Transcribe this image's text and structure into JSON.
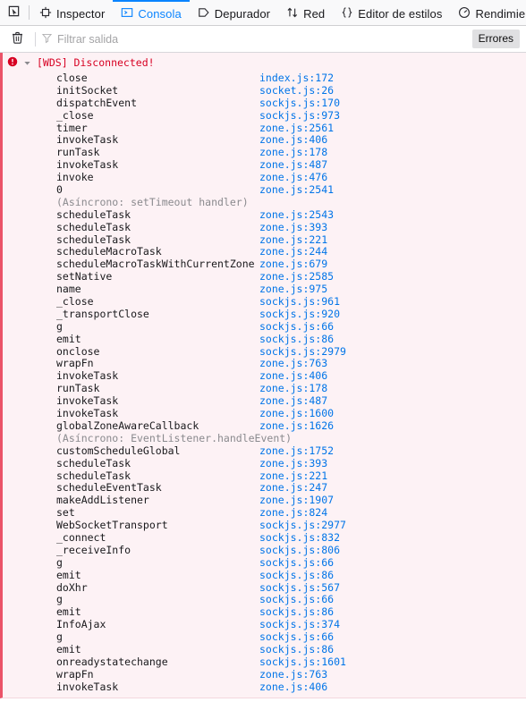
{
  "toolbox": {
    "picker_icon": "element-picker-icon",
    "tabs": [
      {
        "id": "inspector",
        "label": "Inspector",
        "icon": "inspector-target-icon",
        "selected": false
      },
      {
        "id": "console",
        "label": "Consola",
        "icon": "console-prompt-icon",
        "selected": true
      },
      {
        "id": "debugger",
        "label": "Depurador",
        "icon": "debugger-icon",
        "selected": false
      },
      {
        "id": "network",
        "label": "Red",
        "icon": "network-arrows-icon",
        "selected": false
      },
      {
        "id": "styleeditor",
        "label": "Editor de estilos",
        "icon": "braces-icon",
        "selected": false
      },
      {
        "id": "performance",
        "label": "Rendimiento",
        "icon": "gauge-icon",
        "selected": false
      }
    ]
  },
  "console_toolbar": {
    "clear_icon": "trash-icon",
    "filter_icon": "funnel-icon",
    "filter_value": "",
    "filter_placeholder": "Filtrar salida",
    "errors_label": "Errores"
  },
  "colors": {
    "accent": "#0a84ff",
    "link": "#0074e8",
    "error_text": "#d70022",
    "error_bg": "#fdf2f5",
    "error_border": "#eb5368",
    "async_text": "#8a8a8e",
    "toolbar_bg": "#f9f9fa"
  },
  "message": {
    "severity": "error",
    "icon": "error-circle-icon",
    "twisty": "twisty-expanded-icon",
    "expanded": true,
    "text": "[WDS] Disconnected!"
  },
  "stack_frames": [
    {
      "fn": "close",
      "loc": "index.js:172"
    },
    {
      "fn": "initSocket",
      "loc": "socket.js:26"
    },
    {
      "fn": "dispatchEvent",
      "loc": "sockjs.js:170"
    },
    {
      "fn": "_close",
      "loc": "sockjs.js:973"
    },
    {
      "fn": "timer",
      "loc": "zone.js:2561"
    },
    {
      "fn": "invokeTask",
      "loc": "zone.js:406"
    },
    {
      "fn": "runTask",
      "loc": "zone.js:178"
    },
    {
      "fn": "invokeTask",
      "loc": "zone.js:487"
    },
    {
      "fn": "invoke",
      "loc": "zone.js:476"
    },
    {
      "fn": "0",
      "loc": "zone.js:2541"
    },
    {
      "async": "(Asíncrono: setTimeout handler)"
    },
    {
      "fn": "scheduleTask",
      "loc": "zone.js:2543"
    },
    {
      "fn": "scheduleTask",
      "loc": "zone.js:393"
    },
    {
      "fn": "scheduleTask",
      "loc": "zone.js:221"
    },
    {
      "fn": "scheduleMacroTask",
      "loc": "zone.js:244"
    },
    {
      "fn": "scheduleMacroTaskWithCurrentZone",
      "loc": "zone.js:679"
    },
    {
      "fn": "setNative",
      "loc": "zone.js:2585"
    },
    {
      "fn": "name",
      "loc": "zone.js:975"
    },
    {
      "fn": "_close",
      "loc": "sockjs.js:961"
    },
    {
      "fn": "_transportClose",
      "loc": "sockjs.js:920"
    },
    {
      "fn": "g",
      "loc": "sockjs.js:66"
    },
    {
      "fn": "emit",
      "loc": "sockjs.js:86"
    },
    {
      "fn": "onclose",
      "loc": "sockjs.js:2979"
    },
    {
      "fn": "wrapFn",
      "loc": "zone.js:763"
    },
    {
      "fn": "invokeTask",
      "loc": "zone.js:406"
    },
    {
      "fn": "runTask",
      "loc": "zone.js:178"
    },
    {
      "fn": "invokeTask",
      "loc": "zone.js:487"
    },
    {
      "fn": "invokeTask",
      "loc": "zone.js:1600"
    },
    {
      "fn": "globalZoneAwareCallback",
      "loc": "zone.js:1626"
    },
    {
      "async": "(Asíncrono: EventListener.handleEvent)"
    },
    {
      "fn": "customScheduleGlobal",
      "loc": "zone.js:1752"
    },
    {
      "fn": "scheduleTask",
      "loc": "zone.js:393"
    },
    {
      "fn": "scheduleTask",
      "loc": "zone.js:221"
    },
    {
      "fn": "scheduleEventTask",
      "loc": "zone.js:247"
    },
    {
      "fn": "makeAddListener",
      "loc": "zone.js:1907"
    },
    {
      "fn": "set",
      "loc": "zone.js:824"
    },
    {
      "fn": "WebSocketTransport",
      "loc": "sockjs.js:2977"
    },
    {
      "fn": "_connect",
      "loc": "sockjs.js:832"
    },
    {
      "fn": "_receiveInfo",
      "loc": "sockjs.js:806"
    },
    {
      "fn": "g",
      "loc": "sockjs.js:66"
    },
    {
      "fn": "emit",
      "loc": "sockjs.js:86"
    },
    {
      "fn": "doXhr",
      "loc": "sockjs.js:567"
    },
    {
      "fn": "g",
      "loc": "sockjs.js:66"
    },
    {
      "fn": "emit",
      "loc": "sockjs.js:86"
    },
    {
      "fn": "InfoAjax",
      "loc": "sockjs.js:374"
    },
    {
      "fn": "g",
      "loc": "sockjs.js:66"
    },
    {
      "fn": "emit",
      "loc": "sockjs.js:86"
    },
    {
      "fn": "onreadystatechange",
      "loc": "sockjs.js:1601"
    },
    {
      "fn": "wrapFn",
      "loc": "zone.js:763"
    },
    {
      "fn": "invokeTask",
      "loc": "zone.js:406"
    }
  ]
}
